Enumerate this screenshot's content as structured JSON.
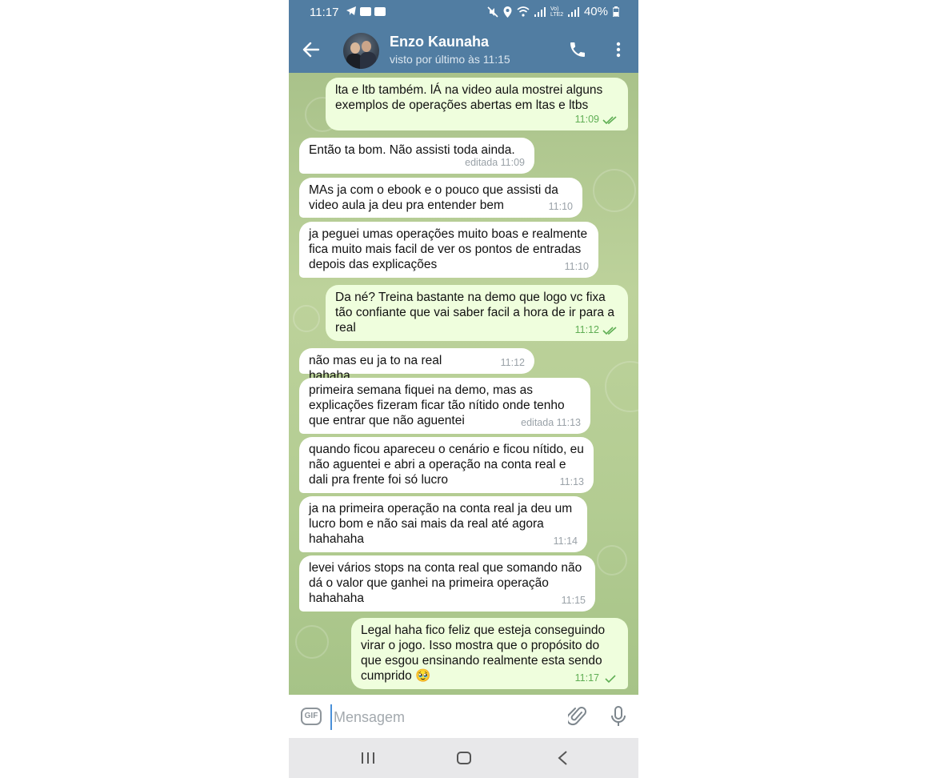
{
  "status_bar": {
    "time": "11:17",
    "network_label": "Vo) LTE2",
    "battery": "40%"
  },
  "header": {
    "contact_name": "Enzo Kaunaha",
    "last_seen": "visto por último às 11:15"
  },
  "messages": [
    {
      "direction": "out",
      "text": "lta e ltb também. lÁ na video aula mostrei alguns exemplos de operações abertas em ltas e ltbs",
      "time": "11:09",
      "status": "read"
    },
    {
      "direction": "in",
      "text": "Então ta bom. Não assisti toda ainda.",
      "time": "editada 11:09"
    },
    {
      "direction": "in",
      "text": "MAs ja com o ebook e o pouco que assisti da video aula ja deu pra entender bem",
      "time": "11:10"
    },
    {
      "direction": "in",
      "text": "ja peguei umas operações muito boas e realmente fica muito mais facil de ver os pontos de entradas depois das explicações",
      "time": "11:10"
    },
    {
      "direction": "out",
      "text": "Da né? Treina bastante na demo que logo vc fixa tão confiante que vai saber facil a hora de ir para a real",
      "time": "11:12",
      "status": "read"
    },
    {
      "direction": "in",
      "text": "não mas eu ja to na real hahaha",
      "time": "11:12"
    },
    {
      "direction": "in",
      "text": "primeira semana fiquei na demo, mas as explicações fizeram ficar tão nítido onde tenho que entrar que não aguentei",
      "time": "editada 11:13"
    },
    {
      "direction": "in",
      "text": "quando ficou apareceu o cenário e ficou nítido, eu não aguentei e abri a operação na conta real e dali pra frente foi só lucro",
      "time": "11:13"
    },
    {
      "direction": "in",
      "text": "ja na primeira operação na conta real ja deu um lucro bom e não sai mais da real até agora hahahaha",
      "time": "11:14"
    },
    {
      "direction": "in",
      "text": "levei vários stops na conta real que somando não dá o valor que ganhei na primeira operação hahahaha",
      "time": "11:15"
    },
    {
      "direction": "out",
      "text": "Legal haha fico feliz que esteja conseguindo virar o jogo. Isso mostra que o propósito do que esgou ensinando realmente esta sendo cumprido 🥹",
      "time": "11:17",
      "status": "sent"
    }
  ],
  "input": {
    "placeholder": "Mensagem",
    "gif_label": "GIF"
  },
  "colors": {
    "header": "#517DA2",
    "outgoing_bubble": "#effedd",
    "incoming_bubble": "#ffffff",
    "tick": "#5fae54"
  }
}
